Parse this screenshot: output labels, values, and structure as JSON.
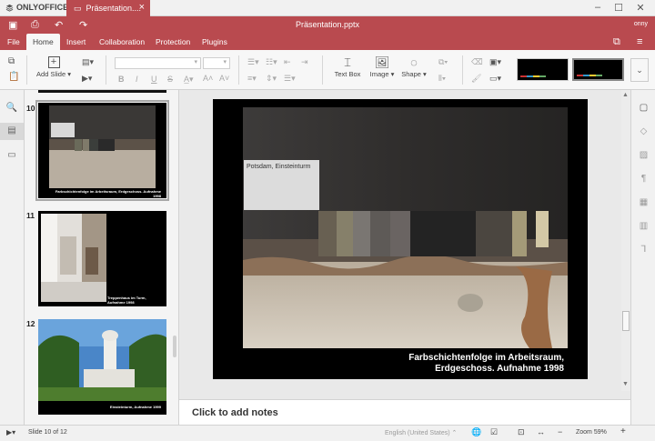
{
  "app": {
    "brand": "ONLYOFFICE",
    "tab_title": "Präsentation....",
    "doc_title": "Präsentation.pptx",
    "user": "onny"
  },
  "menu_tabs": [
    "File",
    "Home",
    "Insert",
    "Collaboration",
    "Protection",
    "Plugins"
  ],
  "active_tab": "Home",
  "toolbar": {
    "add_slide": "Add Slide",
    "text_box": "Text Box",
    "image": "Image",
    "shape": "Shape"
  },
  "slides": [
    {
      "number": "10",
      "caption": "Farbschichtenfolge im Arbeitsraum, Erdgeschoss. Aufnahme 1998",
      "selected": true
    },
    {
      "number": "11",
      "caption": "Treppenhaus im Turm, Aufnahme 1998",
      "selected": false
    },
    {
      "number": "12",
      "caption": "Einsteinturm, Aufnahme 1999",
      "selected": false
    }
  ],
  "current_slide": {
    "caption_line1": "Farbschichtenfolge im Arbeitsraum,",
    "caption_line2": "Erdgeschoss. Aufnahme 1998",
    "label_card": "Potsdam, Einsteinturm"
  },
  "notes_placeholder": "Click to add notes",
  "status": {
    "slide_info": "Slide 10 of 12",
    "language": "English (United States)",
    "zoom": "Zoom 59%"
  },
  "colors": {
    "accent": "#b94a4f",
    "toolbar_bg": "#f7f7f7",
    "panel_bg": "#f4f4f4"
  }
}
